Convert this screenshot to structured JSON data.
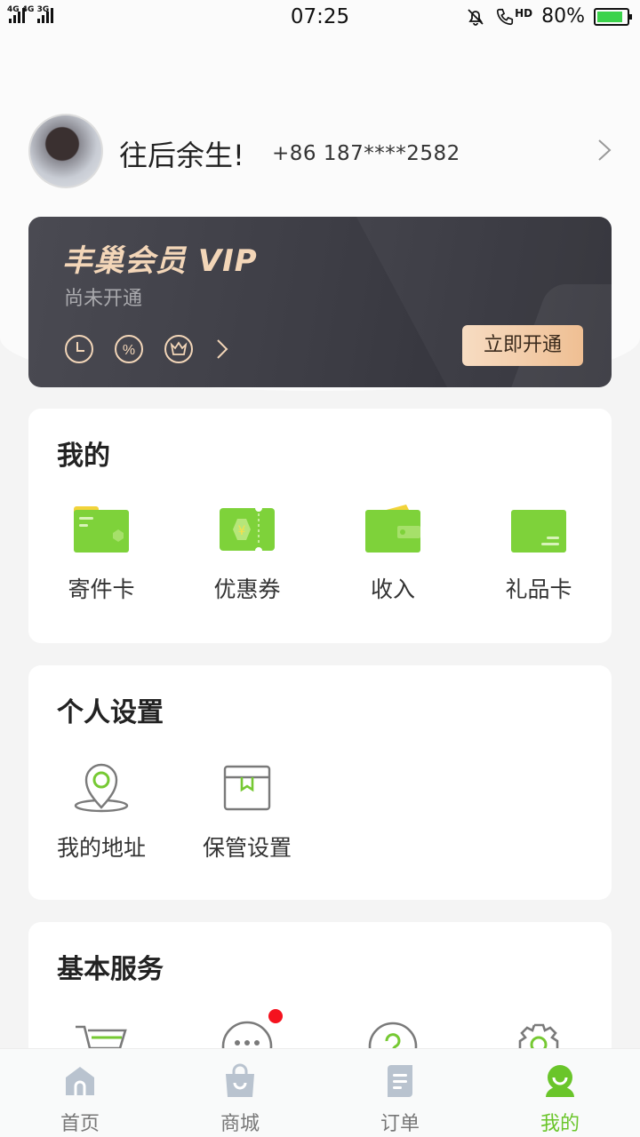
{
  "status_bar": {
    "network": "4G 4G 3G",
    "time": "07:25",
    "call_label": "HD",
    "battery": "80%",
    "battery_level": 0.8
  },
  "profile": {
    "username": "往后余生!",
    "phone": "+86 187****2582"
  },
  "vip": {
    "title": "丰巢会员 VIP",
    "status": "尚未开通",
    "button": "立即开通",
    "icons": [
      "clock-icon",
      "percent-icon",
      "crown-icon"
    ]
  },
  "mine": {
    "title": "我的",
    "items": [
      {
        "label": "寄件卡",
        "icon": "card-icon"
      },
      {
        "label": "优惠券",
        "icon": "coupon-icon"
      },
      {
        "label": "收入",
        "icon": "wallet-icon"
      },
      {
        "label": "礼品卡",
        "icon": "gift-card-icon"
      }
    ]
  },
  "settings": {
    "title": "个人设置",
    "items": [
      {
        "label": "我的地址",
        "icon": "location-icon"
      },
      {
        "label": "保管设置",
        "icon": "box-icon"
      }
    ]
  },
  "services": {
    "title": "基本服务",
    "items": [
      {
        "icon": "cart-icon"
      },
      {
        "icon": "chat-icon",
        "has_badge": true
      },
      {
        "icon": "help-icon"
      },
      {
        "icon": "settings-gear-icon"
      }
    ]
  },
  "tabbar": {
    "tabs": [
      {
        "label": "首页",
        "icon": "home-icon"
      },
      {
        "label": "商城",
        "icon": "shopping-bag-icon"
      },
      {
        "label": "订单",
        "icon": "order-icon"
      },
      {
        "label": "我的",
        "icon": "profile-icon",
        "active": true
      }
    ]
  },
  "colors": {
    "accent_green": "#6ac52a",
    "vip_gold": "#f3d6b8",
    "badge_red": "#f5121e"
  }
}
